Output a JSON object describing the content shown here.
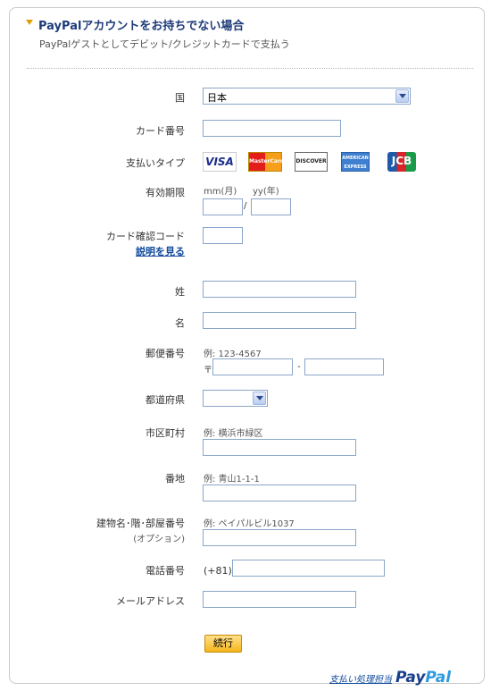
{
  "header": {
    "title": "PayPalアカウントをお持ちでない場合",
    "subtitle": "PayPalゲストとしてデビット/クレジットカードで支払う"
  },
  "form": {
    "country": {
      "label": "国",
      "value": "日本"
    },
    "card_number": {
      "label": "カード番号",
      "value": ""
    },
    "card_types": {
      "label": "支払いタイプ",
      "items": [
        "VISA",
        "MasterCard",
        "DISCOVER",
        "AMERICAN EXPRESS",
        "JCB"
      ]
    },
    "expiry": {
      "label": "有効期限",
      "month_hint": "mm(月)",
      "year_hint": "yy(年)",
      "separator": "/"
    },
    "cvv": {
      "label": "カード確認コード",
      "help_link": "説明を見る"
    },
    "last_name": {
      "label": "姓"
    },
    "first_name": {
      "label": "名"
    },
    "postal_code": {
      "label": "郵便番号",
      "example": "例: 123-4567",
      "prefix": "〒",
      "separator": "-"
    },
    "prefecture": {
      "label": "都道府県",
      "value": ""
    },
    "city": {
      "label": "市区町村",
      "example": "例: 横浜市緑区"
    },
    "address": {
      "label": "番地",
      "example": "例: 青山1-1-1"
    },
    "building": {
      "label": "建物名･階･部屋番号",
      "optional": "(オプション)",
      "example": "例: ペイパルビル1037"
    },
    "phone": {
      "label": "電話番号",
      "prefix": "(+81)"
    },
    "email": {
      "label": "メールアドレス"
    },
    "continue_button": "続行"
  },
  "footer": {
    "processed_by": "支払い処理担当",
    "brand_pay": "Pay",
    "brand_pal": "Pal"
  },
  "colors": {
    "title": "#1e3c7a",
    "link": "#0f4a9c",
    "button": "#f6b51c",
    "input_border": "#8aa6c8"
  }
}
